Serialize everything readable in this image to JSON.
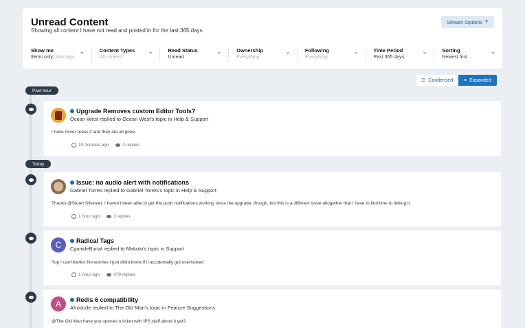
{
  "page": {
    "title": "Unread Content",
    "subtitle": "Showing all content I have not read and posted in for the last 365 days.",
    "stream_options_label": "Stream Options"
  },
  "filters": [
    {
      "label": "Show me",
      "value": "Items only;",
      "value_muted": "Any tags"
    },
    {
      "label": "Content Types",
      "value": "",
      "value_muted": "All content"
    },
    {
      "label": "Read Status",
      "value": "Unread",
      "value_muted": ""
    },
    {
      "label": "Ownership",
      "value": "",
      "value_muted": "Everything"
    },
    {
      "label": "Following",
      "value": "",
      "value_muted": "Everything"
    },
    {
      "label": "Time Period",
      "value": "Past 365 days",
      "value_muted": ""
    },
    {
      "label": "Sorting",
      "value": "Newest first",
      "value_muted": ""
    }
  ],
  "view_toggle": {
    "condensed": "Condensed",
    "expanded": "Expanded",
    "active": "expanded"
  },
  "time_groups": [
    "Past hour",
    "Today"
  ],
  "items": [
    {
      "title": "Upgrade Removes custom Editor Tools?",
      "meta": "Ocean West replied to Ocean West's topic in Help & Support",
      "snippet": "I have never press it and they are all gone.",
      "time": "10 minutes ago",
      "replies": "2 replies",
      "avatar_color": "#e8a33a"
    },
    {
      "title": "Issue: no audio alert with notifications",
      "meta": "Gabriel Torres replied to Gabriel Torres's topic in Help & Support",
      "snippet": "Thanks @Stuart Silvester. I haven't been able to get the push notifications working since the upgrade, though, but this is a different issue altogether that I have to find time to debug it.",
      "time": "1 hour ago",
      "replies": "3 replies",
      "avatar_color": "#8a6a4e"
    },
    {
      "title": "Radical Tags",
      "meta": "CyanideBurial replied to Makoto's topic in Support",
      "snippet": "Yup I can thanks! No worries I just didnt know if it accidentally got overlooked",
      "time": "1 hour ago",
      "replies": "479 replies",
      "avatar_letter": "C",
      "avatar_color": "#5a5fbf"
    },
    {
      "title": "Redis 6 compatibility",
      "meta": "Afrodude replied to The Old Man's topic in Feature Suggestions",
      "snippet": "@The Old Man have you opened a ticket with IPS staff about it yet?",
      "avatar_letter": "A",
      "avatar_color": "#c04d86"
    }
  ]
}
